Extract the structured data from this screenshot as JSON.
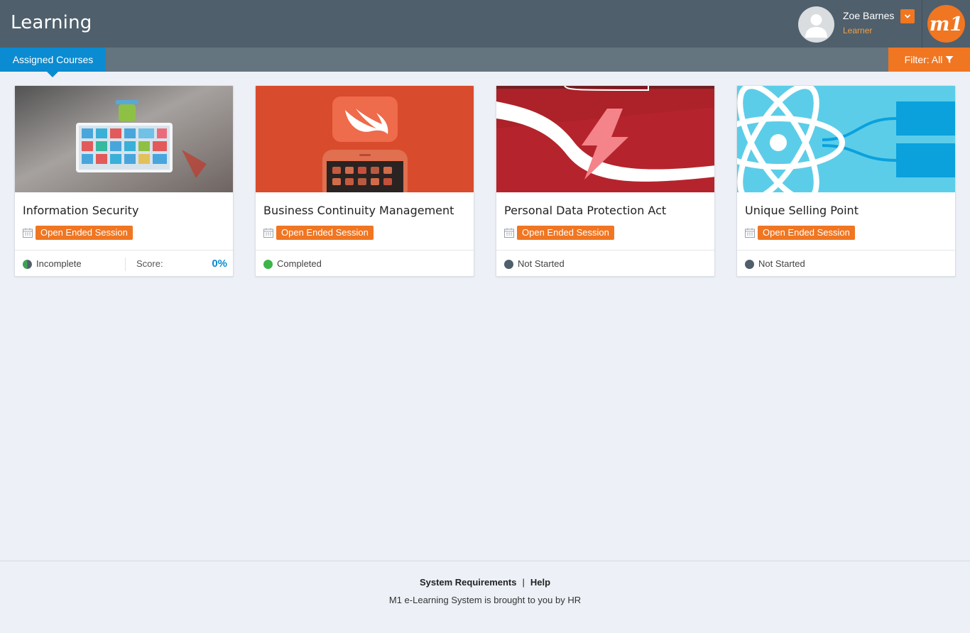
{
  "header": {
    "title": "Learning",
    "user": {
      "name": "Zoe Barnes",
      "role": "Learner"
    },
    "logo_text": "m1"
  },
  "subbar": {
    "tab_label": "Assigned Courses",
    "filter_label": "Filter: All"
  },
  "courses": [
    {
      "title": "Information Security",
      "session": "Open Ended Session",
      "status": "Incomplete",
      "status_color": "#3da350",
      "score_label": "Score:",
      "score": "0%",
      "icon": "devices-apps-image"
    },
    {
      "title": "Business Continuity Management",
      "session": "Open Ended Session",
      "status": "Completed",
      "status_color": "#3bb54a",
      "icon": "swift-logo-image"
    },
    {
      "title": "Personal Data Protection Act",
      "session": "Open Ended Session",
      "status": "Not Started",
      "status_color": "#4f5f6b",
      "icon": "lightning-bolt-image"
    },
    {
      "title": "Unique Selling Point",
      "session": "Open Ended Session",
      "status": "Not Started",
      "status_color": "#4f5f6b",
      "icon": "atom-react-image"
    }
  ],
  "footer": {
    "links": [
      "System Requirements",
      "Help"
    ],
    "text": "M1 e-Learning System is brought to you by HR"
  },
  "colors": {
    "accent": "#f07622",
    "primary": "#0b8bd1",
    "header": "#4f5f6b"
  }
}
